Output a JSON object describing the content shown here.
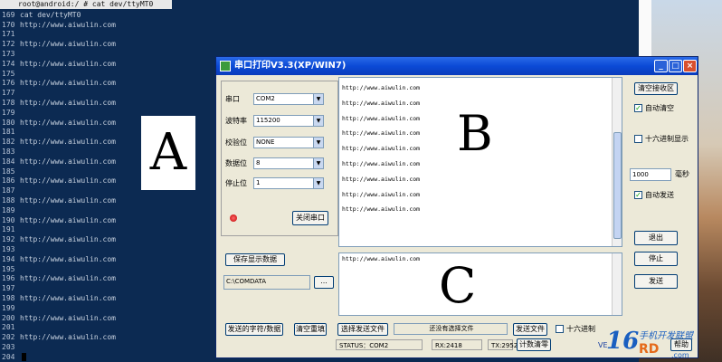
{
  "terminal": {
    "title_line": "root@android:/ # cat dev/ttyMT0",
    "lines": [
      {
        "n": "168",
        "t": "root@android:/ # cat dev/ttyMT0"
      },
      {
        "n": "169",
        "t": "cat dev/ttyMT0"
      },
      {
        "n": "170",
        "t": "http://www.aiwulin.com"
      },
      {
        "n": "171",
        "t": ""
      },
      {
        "n": "172",
        "t": "http://www.aiwulin.com"
      },
      {
        "n": "173",
        "t": ""
      },
      {
        "n": "174",
        "t": "http://www.aiwulin.com"
      },
      {
        "n": "175",
        "t": ""
      },
      {
        "n": "176",
        "t": "http://www.aiwulin.com"
      },
      {
        "n": "177",
        "t": ""
      },
      {
        "n": "178",
        "t": "http://www.aiwulin.com"
      },
      {
        "n": "179",
        "t": ""
      },
      {
        "n": "180",
        "t": "http://www.aiwulin.com"
      },
      {
        "n": "181",
        "t": ""
      },
      {
        "n": "182",
        "t": "http://www.aiwulin.com"
      },
      {
        "n": "183",
        "t": ""
      },
      {
        "n": "184",
        "t": "http://www.aiwulin.com"
      },
      {
        "n": "185",
        "t": ""
      },
      {
        "n": "186",
        "t": "http://www.aiwulin.com"
      },
      {
        "n": "187",
        "t": ""
      },
      {
        "n": "188",
        "t": "http://www.aiwulin.com"
      },
      {
        "n": "189",
        "t": ""
      },
      {
        "n": "190",
        "t": "http://www.aiwulin.com"
      },
      {
        "n": "191",
        "t": ""
      },
      {
        "n": "192",
        "t": "http://www.aiwulin.com"
      },
      {
        "n": "193",
        "t": ""
      },
      {
        "n": "194",
        "t": "http://www.aiwulin.com"
      },
      {
        "n": "195",
        "t": ""
      },
      {
        "n": "196",
        "t": "http://www.aiwulin.com"
      },
      {
        "n": "197",
        "t": ""
      },
      {
        "n": "198",
        "t": "http://www.aiwulin.com"
      },
      {
        "n": "199",
        "t": ""
      },
      {
        "n": "200",
        "t": "http://www.aiwulin.com"
      },
      {
        "n": "201",
        "t": ""
      },
      {
        "n": "202",
        "t": "http://www.aiwulin.com"
      },
      {
        "n": "203",
        "t": ""
      },
      {
        "n": "204",
        "t": ""
      }
    ],
    "marker": "A"
  },
  "app": {
    "title": "串口打印V3.3(XP/WIN7)",
    "settings": {
      "port_label": "串口",
      "port_value": "COM2",
      "baud_label": "波特率",
      "baud_value": "115200",
      "parity_label": "校验位",
      "parity_value": "NONE",
      "databits_label": "数据位",
      "databits_value": "8",
      "stopbits_label": "停止位",
      "stopbits_value": "1",
      "close_port": "关闭串口"
    },
    "save_display": "保存显示数据",
    "save_path": "C:\\COMDATA",
    "browse": "...",
    "receive": {
      "lines": [
        "http://www.aiwulin.com",
        "http://www.aiwulin.com",
        "http://www.aiwulin.com",
        "http://www.aiwulin.com",
        "http://www.aiwulin.com",
        "http://www.aiwulin.com",
        "http://www.aiwulin.com",
        "http://www.aiwulin.com",
        "http://www.aiwulin.com"
      ],
      "marker": "B"
    },
    "send": {
      "text": "http://www.aiwulin.com",
      "marker": "C"
    },
    "right": {
      "clear_rx": "清空接收区",
      "auto_clear": "自动清空",
      "hex_display": "十六进制显示",
      "interval_value": "1000",
      "interval_unit": "毫秒",
      "auto_send": "自动发送",
      "exit": "退出",
      "stop": "停止",
      "send": "发送"
    },
    "bottom": {
      "sent_chars": "发送的字符/数据",
      "clear_resend": "清空重填",
      "choose_file": "选择发送文件",
      "no_file": "还没有选择文件",
      "send_file": "发送文件",
      "hex": "十六进制"
    },
    "status": {
      "port": "STATUS：COM2",
      "rx": "RX:2418",
      "tx": "TX:2952",
      "reset_count": "计数清零",
      "help": "帮助",
      "version_abbr": "VE"
    }
  },
  "watermark": {
    "num": "16",
    "cn": "手机开发联盟",
    "rd": "RD",
    "site": ".com"
  }
}
